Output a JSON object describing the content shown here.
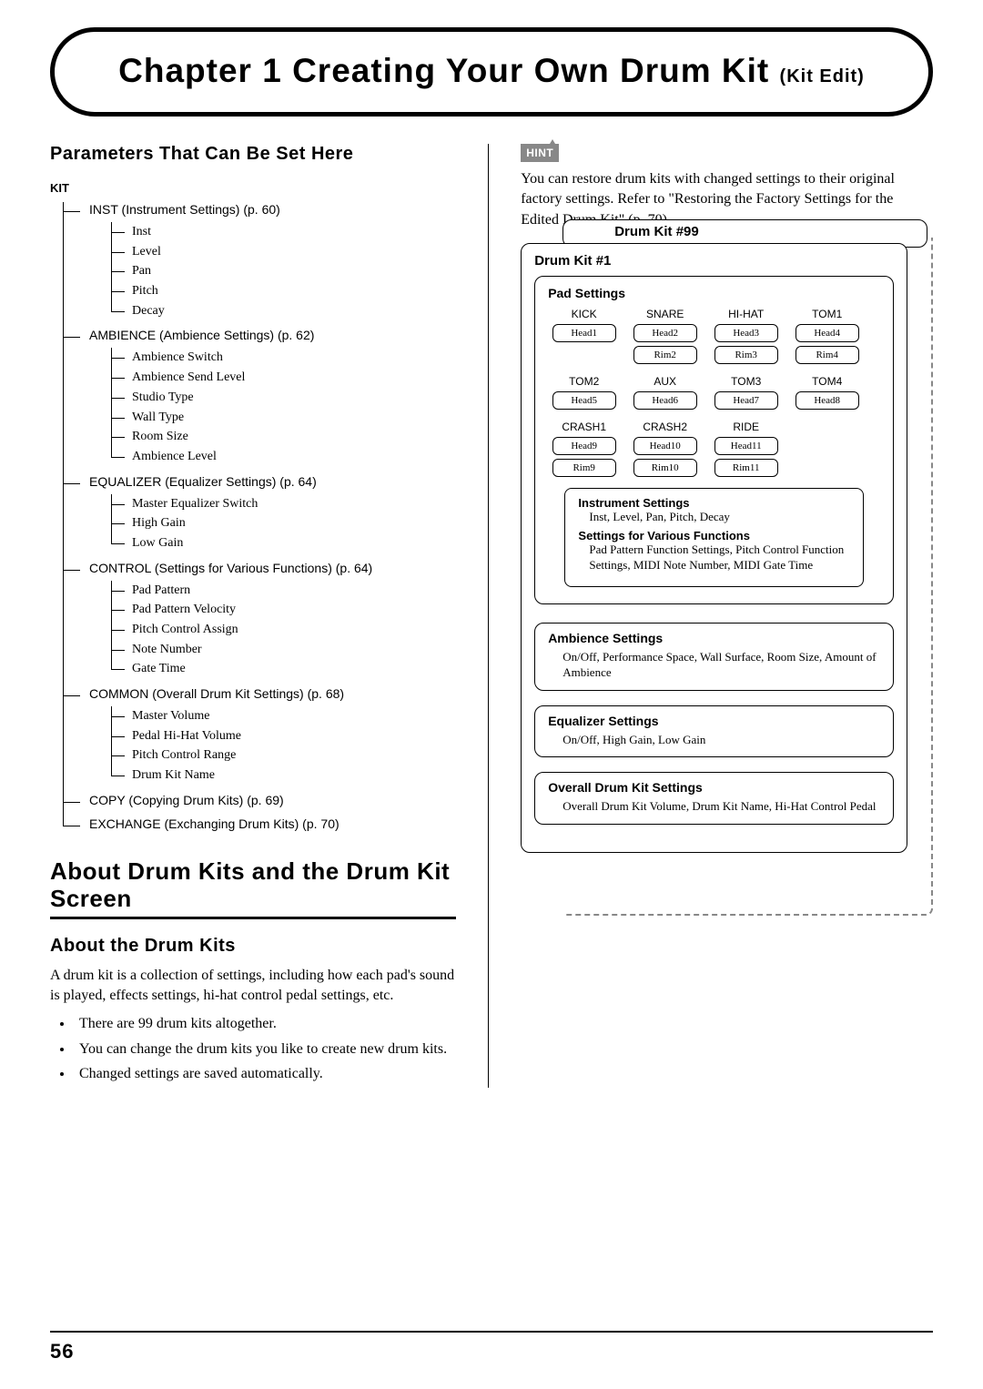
{
  "chapter": {
    "title": "Chapter 1 Creating Your Own Drum Kit",
    "subtitle": "(Kit Edit)"
  },
  "left": {
    "params_heading": "Parameters That Can Be Set Here",
    "kit_label": "KIT",
    "tree": [
      {
        "title": "INST (Instrument Settings) (p. 60)",
        "items": [
          "Inst",
          "Level",
          "Pan",
          "Pitch",
          "Decay"
        ]
      },
      {
        "title": "AMBIENCE (Ambience Settings) (p. 62)",
        "items": [
          "Ambience Switch",
          "Ambience Send Level",
          "Studio Type",
          "Wall Type",
          "Room Size",
          "Ambience Level"
        ]
      },
      {
        "title": "EQUALIZER (Equalizer Settings) (p. 64)",
        "items": [
          "Master Equalizer Switch",
          "High Gain",
          "Low Gain"
        ]
      },
      {
        "title": "CONTROL (Settings for Various Functions) (p. 64)",
        "items": [
          "Pad Pattern",
          "Pad Pattern Velocity",
          "Pitch Control Assign",
          "Note Number",
          "Gate Time"
        ]
      },
      {
        "title": "COMMON (Overall Drum Kit Settings) (p. 68)",
        "items": [
          "Master Volume",
          "Pedal Hi-Hat Volume",
          "Pitch Control Range",
          "Drum Kit Name"
        ]
      },
      {
        "title": "COPY (Copying Drum Kits) (p. 69)",
        "items": []
      },
      {
        "title": "EXCHANGE (Exchanging Drum Kits) (p. 70)",
        "items": []
      }
    ],
    "about_heading": "About Drum Kits and the Drum Kit Screen",
    "about_sub": "About the Drum Kits",
    "about_para": "A drum kit is a collection of settings, including how each pad's sound is played, effects settings, hi-hat control pedal settings, etc.",
    "about_bullets": [
      "There are 99 drum kits altogether.",
      "You can change the drum kits you like to create new drum kits.",
      "Changed settings are saved automatically."
    ]
  },
  "right": {
    "hint_label": "HINT",
    "hint_text": "You can restore drum kits with changed settings to their original factory settings. Refer to \"Restoring the Factory Settings for the Edited Drum Kit\" (p. 70).",
    "behind_title": "Drum Kit #99",
    "front_title": "Drum Kit #1",
    "pad_title": "Pad Settings",
    "pad_rows": [
      [
        {
          "name": "KICK",
          "boxes": [
            "Head1"
          ]
        },
        {
          "name": "SNARE",
          "boxes": [
            "Head2",
            "Rim2"
          ]
        },
        {
          "name": "HI-HAT",
          "boxes": [
            "Head3",
            "Rim3"
          ]
        },
        {
          "name": "TOM1",
          "boxes": [
            "Head4",
            "Rim4"
          ]
        }
      ],
      [
        {
          "name": "TOM2",
          "boxes": [
            "Head5"
          ]
        },
        {
          "name": "AUX",
          "boxes": [
            "Head6"
          ]
        },
        {
          "name": "TOM3",
          "boxes": [
            "Head7"
          ]
        },
        {
          "name": "TOM4",
          "boxes": [
            "Head8"
          ]
        }
      ],
      [
        {
          "name": "CRASH1",
          "boxes": [
            "Head9",
            "Rim9"
          ]
        },
        {
          "name": "CRASH2",
          "boxes": [
            "Head10",
            "Rim10"
          ]
        },
        {
          "name": "RIDE",
          "boxes": [
            "Head11",
            "Rim11"
          ]
        },
        {
          "name": "",
          "boxes": []
        }
      ]
    ],
    "inst_settings": {
      "title": "Instrument Settings",
      "desc": "Inst, Level, Pan, Pitch, Decay",
      "title2": "Settings for Various Functions",
      "desc2": "Pad Pattern Function Settings, Pitch Control Function Settings, MIDI Note Number, MIDI Gate Time"
    },
    "sections": [
      {
        "title": "Ambience Settings",
        "desc": "On/Off, Performance Space, Wall Surface, Room Size, Amount of Ambience"
      },
      {
        "title": "Equalizer Settings",
        "desc": "On/Off, High Gain, Low Gain"
      },
      {
        "title": "Overall Drum Kit Settings",
        "desc": "Overall Drum Kit Volume, Drum Kit Name, Hi-Hat Control Pedal"
      }
    ]
  },
  "page_number": "56"
}
